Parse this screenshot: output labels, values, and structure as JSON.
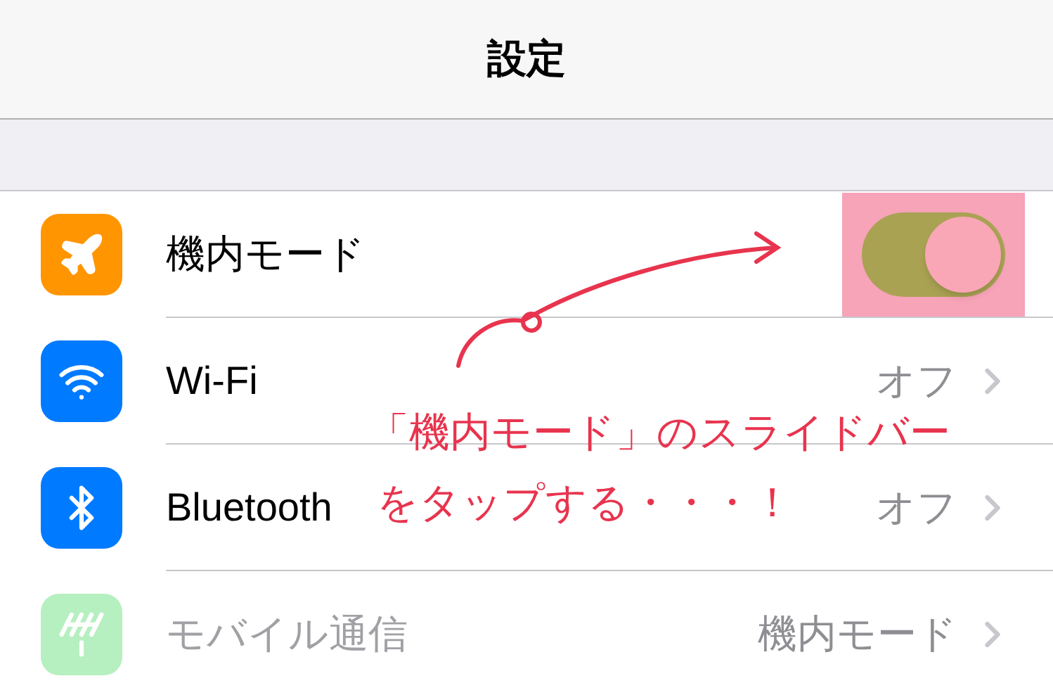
{
  "nav_bar": {
    "title": "設定"
  },
  "rows": [
    {
      "kind": "toggle",
      "label": "機内モード",
      "on": true,
      "highlighted": true,
      "disabled": false
    },
    {
      "kind": "value",
      "label": "Wi-Fi",
      "value": "オフ",
      "disabled": false
    },
    {
      "kind": "value",
      "label": "Bluetooth",
      "value": "オフ",
      "disabled": false
    },
    {
      "kind": "value",
      "label": "モバイル通信",
      "value": "機内モード",
      "disabled": true
    }
  ],
  "annotation": {
    "lines": [
      "「機内モード」のスライドバー",
      "をタップする・・・！"
    ]
  }
}
